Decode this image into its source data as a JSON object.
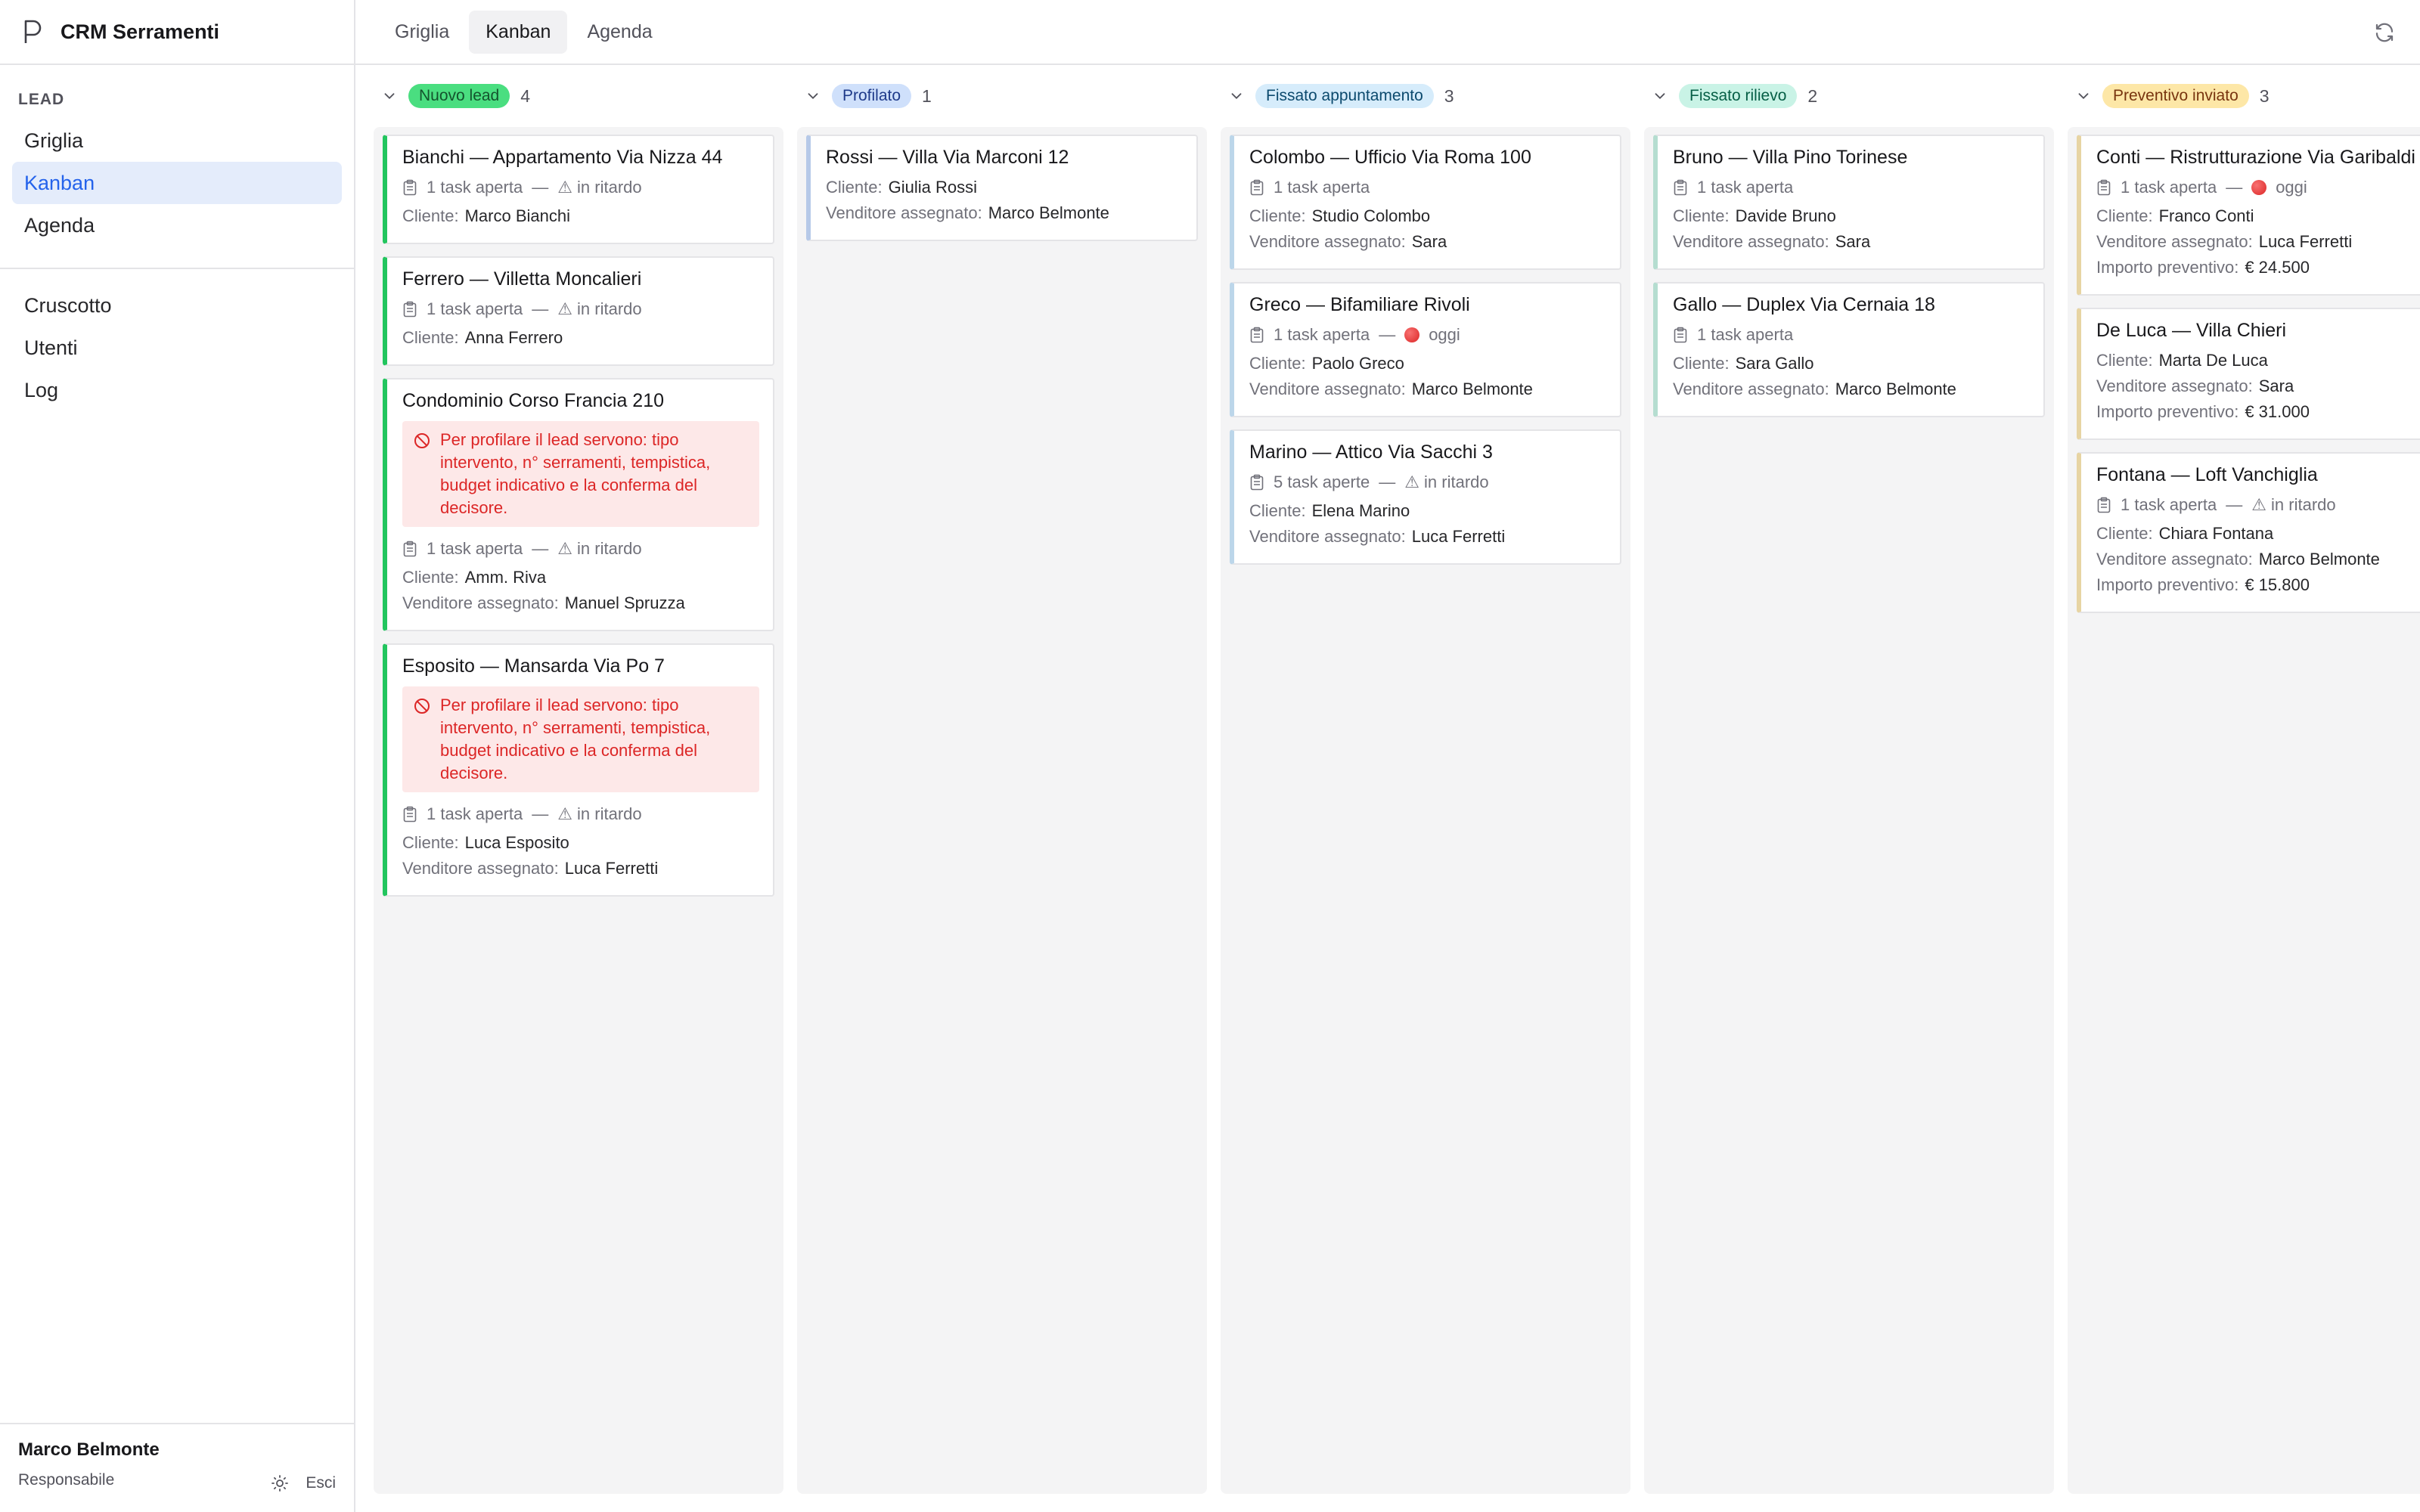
{
  "app": {
    "title": "CRM Serramenti"
  },
  "sidebar": {
    "section_title": "LEAD",
    "lead_items": [
      {
        "label": "Griglia"
      },
      {
        "label": "Kanban",
        "active": true
      },
      {
        "label": "Agenda"
      }
    ],
    "other_items": [
      {
        "label": "Cruscotto"
      },
      {
        "label": "Utenti"
      },
      {
        "label": "Log"
      }
    ],
    "user": {
      "name": "Marco Belmonte",
      "role": "Responsabile",
      "logout_label": "Esci"
    }
  },
  "topbar": {
    "tabs": [
      {
        "label": "Griglia"
      },
      {
        "label": "Kanban",
        "active": true
      },
      {
        "label": "Agenda"
      }
    ]
  },
  "board": {
    "columns": [
      {
        "status": "Nuovo lead",
        "count": "4",
        "badge_bg": "#4ade80",
        "badge_fg": "#14532d",
        "accent": "#22c55e",
        "cards": [
          {
            "title": "Bianchi — Appartamento Via Nizza 44",
            "tasks": "1 task aperta",
            "due": "⚠ in ritardo",
            "fields": [
              {
                "label": "Cliente:",
                "value": "Marco Bianchi"
              }
            ]
          },
          {
            "title": "Ferrero — Villetta Moncalieri",
            "tasks": "1 task aperta",
            "due": "⚠ in ritardo",
            "fields": [
              {
                "label": "Cliente:",
                "value": "Anna Ferrero"
              }
            ]
          },
          {
            "title": "Condominio Corso Francia 210",
            "alert": "Per profilare il lead servono: tipo intervento, n° serramenti, tempistica, budget indicativo e la conferma del decisore.",
            "tasks": "1 task aperta",
            "due": "⚠ in ritardo",
            "fields": [
              {
                "label": "Cliente:",
                "value": "Amm. Riva"
              },
              {
                "label": "Venditore assegnato:",
                "value": "Manuel Spruzza"
              }
            ]
          },
          {
            "title": "Esposito — Mansarda Via Po 7",
            "alert": "Per profilare il lead servono: tipo intervento, n° serramenti, tempistica, budget indicativo e la conferma del decisore.",
            "tasks": "1 task aperta",
            "due": "⚠ in ritardo",
            "fields": [
              {
                "label": "Cliente:",
                "value": "Luca Esposito"
              },
              {
                "label": "Venditore assegnato:",
                "value": "Luca Ferretti"
              }
            ]
          }
        ]
      },
      {
        "status": "Profilato",
        "count": "1",
        "badge_bg": "#cfe0fb",
        "badge_fg": "#1e3a8a",
        "accent": "#b6c9e8",
        "cards": [
          {
            "title": "Rossi — Villa Via Marconi 12",
            "fields": [
              {
                "label": "Cliente:",
                "value": "Giulia Rossi"
              },
              {
                "label": "Venditore assegnato:",
                "value": "Marco Belmonte"
              }
            ]
          }
        ]
      },
      {
        "status": "Fissato appuntamento",
        "count": "3",
        "badge_bg": "#d6ecfb",
        "badge_fg": "#0c4a6e",
        "accent": "#bcd6ea",
        "cards": [
          {
            "title": "Colombo — Ufficio Via Roma 100",
            "tasks": "1 task aperta",
            "fields": [
              {
                "label": "Cliente:",
                "value": "Studio Colombo"
              },
              {
                "label": "Venditore assegnato:",
                "value": "Sara"
              }
            ]
          },
          {
            "title": "Greco — Bifamiliare Rivoli",
            "tasks": "1 task aperta",
            "due_dot": true,
            "due": "oggi",
            "fields": [
              {
                "label": "Cliente:",
                "value": "Paolo Greco"
              },
              {
                "label": "Venditore assegnato:",
                "value": "Marco Belmonte"
              }
            ]
          },
          {
            "title": "Marino — Attico Via Sacchi 3",
            "tasks": "5 task aperte",
            "due": "⚠ in ritardo",
            "fields": [
              {
                "label": "Cliente:",
                "value": "Elena Marino"
              },
              {
                "label": "Venditore assegnato:",
                "value": "Luca Ferretti"
              }
            ]
          }
        ]
      },
      {
        "status": "Fissato rilievo",
        "count": "2",
        "badge_bg": "#c9f3e6",
        "badge_fg": "#065f46",
        "accent": "#b5ddd0",
        "cards": [
          {
            "title": "Bruno — Villa Pino Torinese",
            "tasks": "1 task aperta",
            "fields": [
              {
                "label": "Cliente:",
                "value": "Davide Bruno"
              },
              {
                "label": "Venditore assegnato:",
                "value": "Sara"
              }
            ]
          },
          {
            "title": "Gallo — Duplex Via Cernaia 18",
            "tasks": "1 task aperta",
            "fields": [
              {
                "label": "Cliente:",
                "value": "Sara Gallo"
              },
              {
                "label": "Venditore assegnato:",
                "value": "Marco Belmonte"
              }
            ]
          }
        ]
      },
      {
        "status": "Preventivo inviato",
        "count": "3",
        "badge_bg": "#fde7a7",
        "badge_fg": "#78350f",
        "accent": "#e7d4a3",
        "cards": [
          {
            "title": "Conti — Ristrutturazione Via Garibaldi",
            "tasks": "1 task aperta",
            "due_dot": true,
            "due": "oggi",
            "fields": [
              {
                "label": "Cliente:",
                "value": "Franco Conti"
              },
              {
                "label": "Venditore assegnato:",
                "value": "Luca Ferretti"
              },
              {
                "label": "Importo preventivo:",
                "value": "€ 24.500"
              }
            ]
          },
          {
            "title": "De Luca — Villa Chieri",
            "fields": [
              {
                "label": "Cliente:",
                "value": "Marta De Luca"
              },
              {
                "label": "Venditore assegnato:",
                "value": "Sara"
              },
              {
                "label": "Importo preventivo:",
                "value": "€ 31.000"
              }
            ]
          },
          {
            "title": "Fontana — Loft Vanchiglia",
            "tasks": "1 task aperta",
            "due": "⚠ in ritardo",
            "fields": [
              {
                "label": "Cliente:",
                "value": "Chiara Fontana"
              },
              {
                "label": "Venditore assegnato:",
                "value": "Marco Belmonte"
              },
              {
                "label": "Importo preventivo:",
                "value": "€ 15.800"
              }
            ]
          }
        ]
      }
    ]
  }
}
